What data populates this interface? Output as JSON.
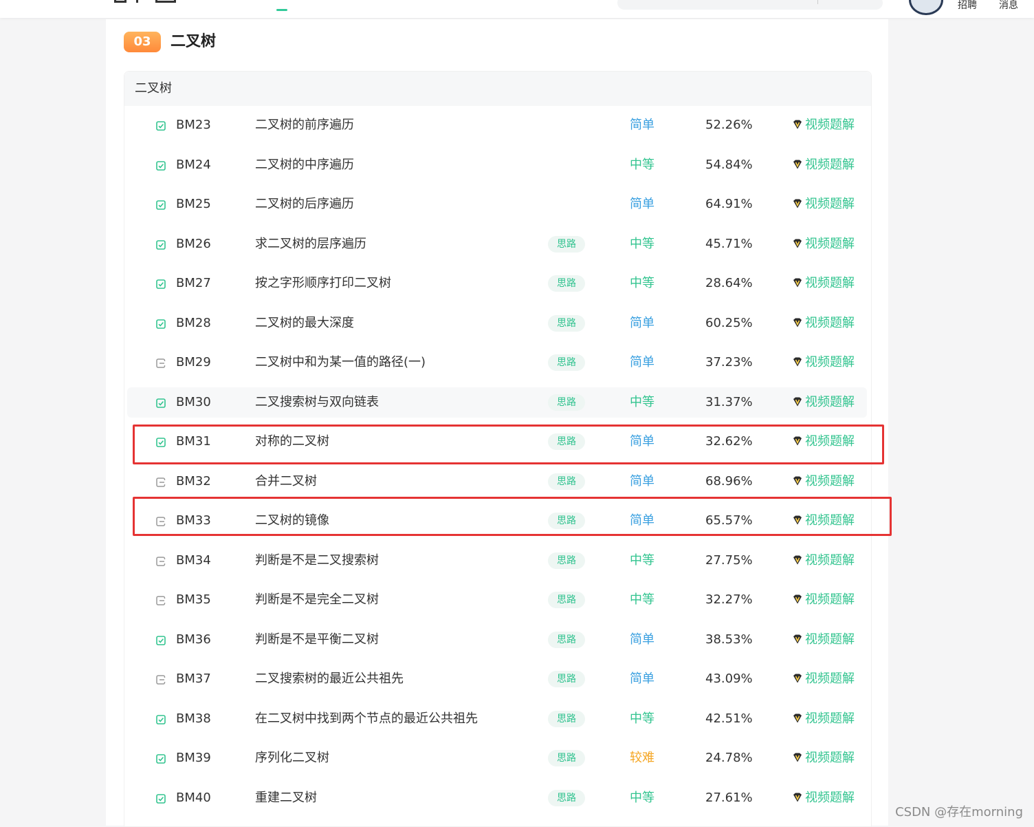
{
  "top_nav": {
    "recruit_label": "招聘",
    "messages_label": "消息"
  },
  "section": {
    "number": "03",
    "title": "二叉树"
  },
  "group": {
    "header": "二叉树"
  },
  "hint_label": "思路",
  "video_label": "视频题解",
  "colors": {
    "accent": "#32c48f",
    "easy": "#3aa0e0",
    "medium": "#32c48f",
    "hard": "#f5a623",
    "highlight_box": "#e53333"
  },
  "problems": [
    {
      "id": "BM23",
      "title": "二叉树的前序遍历",
      "has_hint": false,
      "difficulty": "简单",
      "level": "easy",
      "pass_rate": "52.26%",
      "status": "solved"
    },
    {
      "id": "BM24",
      "title": "二叉树的中序遍历",
      "has_hint": false,
      "difficulty": "中等",
      "level": "medium",
      "pass_rate": "54.84%",
      "status": "solved"
    },
    {
      "id": "BM25",
      "title": "二叉树的后序遍历",
      "has_hint": false,
      "difficulty": "简单",
      "level": "easy",
      "pass_rate": "64.91%",
      "status": "solved"
    },
    {
      "id": "BM26",
      "title": "求二叉树的层序遍历",
      "has_hint": true,
      "difficulty": "中等",
      "level": "medium",
      "pass_rate": "45.71%",
      "status": "solved"
    },
    {
      "id": "BM27",
      "title": "按之字形顺序打印二叉树",
      "has_hint": true,
      "difficulty": "中等",
      "level": "medium",
      "pass_rate": "28.64%",
      "status": "solved"
    },
    {
      "id": "BM28",
      "title": "二叉树的最大深度",
      "has_hint": true,
      "difficulty": "简单",
      "level": "easy",
      "pass_rate": "60.25%",
      "status": "solved"
    },
    {
      "id": "BM29",
      "title": "二叉树中和为某一值的路径(一)",
      "has_hint": true,
      "difficulty": "简单",
      "level": "easy",
      "pass_rate": "37.23%",
      "status": "attempted"
    },
    {
      "id": "BM30",
      "title": "二叉搜索树与双向链表",
      "has_hint": true,
      "difficulty": "中等",
      "level": "medium",
      "pass_rate": "31.37%",
      "status": "solved",
      "hovered": true
    },
    {
      "id": "BM31",
      "title": "对称的二叉树",
      "has_hint": true,
      "difficulty": "简单",
      "level": "easy",
      "pass_rate": "32.62%",
      "status": "solved"
    },
    {
      "id": "BM32",
      "title": "合并二叉树",
      "has_hint": true,
      "difficulty": "简单",
      "level": "easy",
      "pass_rate": "68.96%",
      "status": "attempted"
    },
    {
      "id": "BM33",
      "title": "二叉树的镜像",
      "has_hint": true,
      "difficulty": "简单",
      "level": "easy",
      "pass_rate": "65.57%",
      "status": "attempted"
    },
    {
      "id": "BM34",
      "title": "判断是不是二叉搜索树",
      "has_hint": true,
      "difficulty": "中等",
      "level": "medium",
      "pass_rate": "27.75%",
      "status": "attempted"
    },
    {
      "id": "BM35",
      "title": "判断是不是完全二叉树",
      "has_hint": true,
      "difficulty": "中等",
      "level": "medium",
      "pass_rate": "32.27%",
      "status": "attempted"
    },
    {
      "id": "BM36",
      "title": "判断是不是平衡二叉树",
      "has_hint": true,
      "difficulty": "简单",
      "level": "easy",
      "pass_rate": "38.53%",
      "status": "solved"
    },
    {
      "id": "BM37",
      "title": "二叉搜索树的最近公共祖先",
      "has_hint": true,
      "difficulty": "简单",
      "level": "easy",
      "pass_rate": "43.09%",
      "status": "attempted"
    },
    {
      "id": "BM38",
      "title": "在二叉树中找到两个节点的最近公共祖先",
      "has_hint": true,
      "difficulty": "中等",
      "level": "medium",
      "pass_rate": "42.51%",
      "status": "solved"
    },
    {
      "id": "BM39",
      "title": "序列化二叉树",
      "has_hint": true,
      "difficulty": "较难",
      "level": "hard",
      "pass_rate": "24.78%",
      "status": "solved"
    },
    {
      "id": "BM40",
      "title": "重建二叉树",
      "has_hint": true,
      "difficulty": "中等",
      "level": "medium",
      "pass_rate": "27.61%",
      "status": "solved"
    }
  ],
  "watermark": "CSDN @存在morning"
}
